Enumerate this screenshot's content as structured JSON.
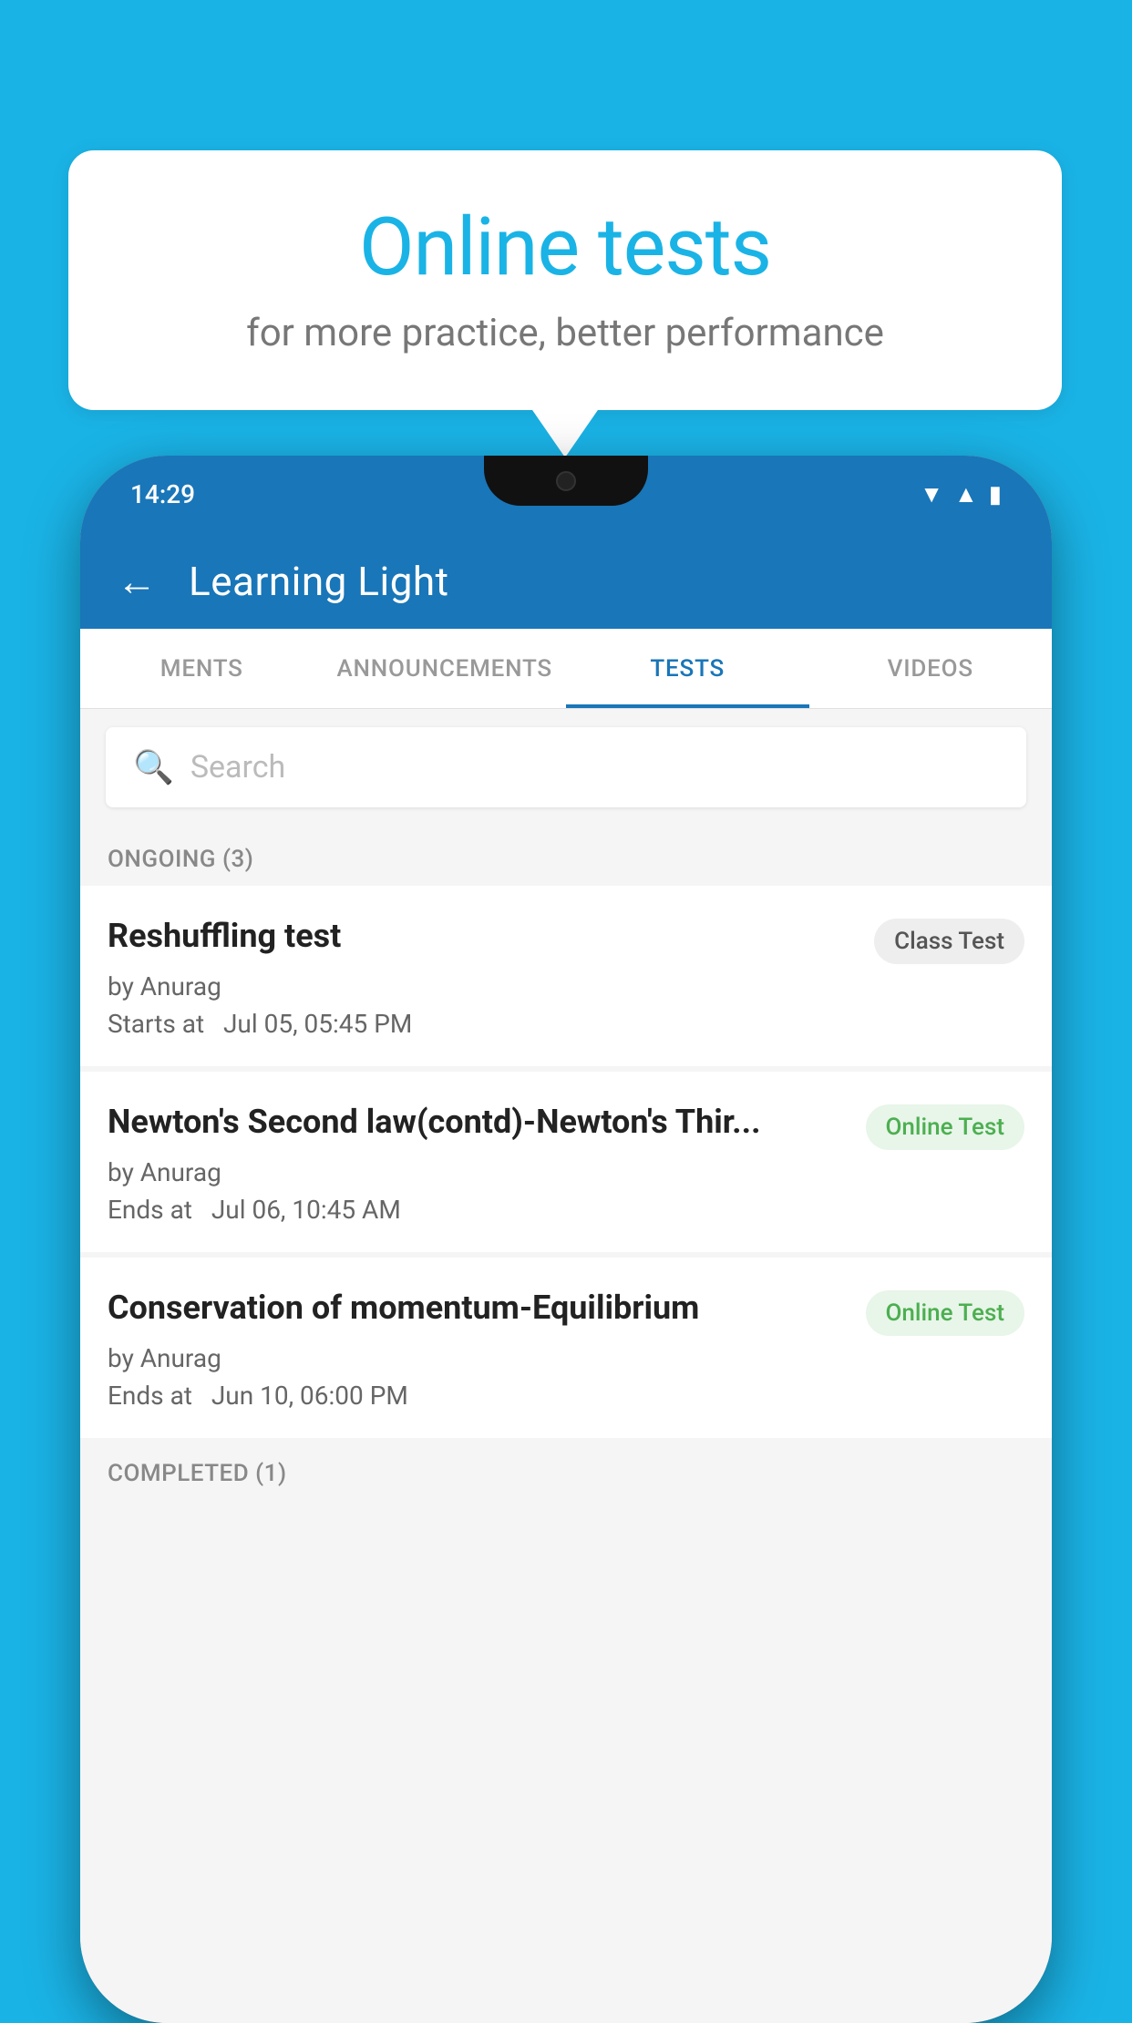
{
  "background": {
    "color": "#1ab3e6"
  },
  "speech_bubble": {
    "title": "Online tests",
    "subtitle": "for more practice, better performance"
  },
  "phone": {
    "status_bar": {
      "time": "14:29",
      "icons": [
        "wifi",
        "signal",
        "battery"
      ]
    },
    "app_bar": {
      "back_label": "←",
      "title": "Learning Light"
    },
    "tabs": [
      {
        "label": "MENTS",
        "active": false
      },
      {
        "label": "ANNOUNCEMENTS",
        "active": false
      },
      {
        "label": "TESTS",
        "active": true
      },
      {
        "label": "VIDEOS",
        "active": false
      }
    ],
    "search": {
      "placeholder": "Search"
    },
    "ongoing_section": {
      "label": "ONGOING (3)",
      "items": [
        {
          "name": "Reshuffling test",
          "badge": "Class Test",
          "badge_type": "class",
          "author": "by Anurag",
          "date_label": "Starts at",
          "date": "Jul 05, 05:45 PM"
        },
        {
          "name": "Newton's Second law(contd)-Newton's Thir...",
          "badge": "Online Test",
          "badge_type": "online",
          "author": "by Anurag",
          "date_label": "Ends at",
          "date": "Jul 06, 10:45 AM"
        },
        {
          "name": "Conservation of momentum-Equilibrium",
          "badge": "Online Test",
          "badge_type": "online",
          "author": "by Anurag",
          "date_label": "Ends at",
          "date": "Jun 10, 06:00 PM"
        }
      ]
    },
    "completed_section": {
      "label": "COMPLETED (1)"
    }
  }
}
